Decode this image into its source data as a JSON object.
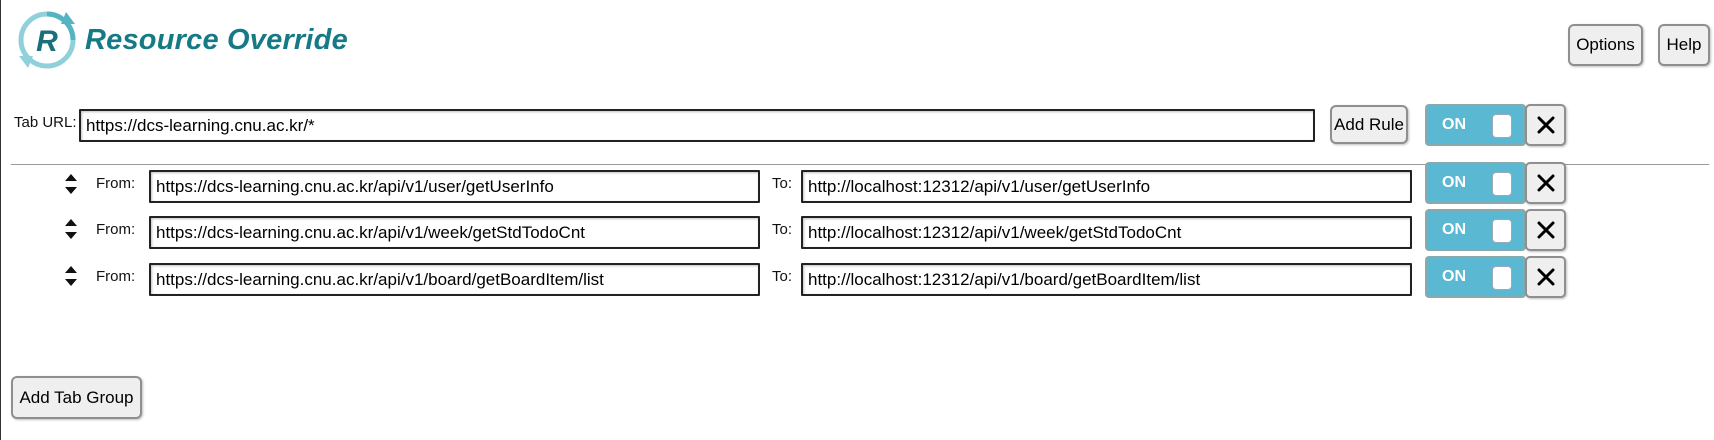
{
  "app": {
    "title": "Resource Override",
    "logo_icon": "resource-override-logo-icon"
  },
  "header": {
    "options_label": "Options",
    "help_label": "Help"
  },
  "tab_group": {
    "tab_url_label": "Tab URL:",
    "tab_url_value": "https://dcs-learning.cnu.ac.kr/*",
    "add_rule_label": "Add Rule",
    "toggle_label": "ON",
    "toggle_state": "on",
    "rules": [
      {
        "from_label": "From:",
        "from_value": "https://dcs-learning.cnu.ac.kr/api/v1/user/getUserInfo",
        "to_label": "To:",
        "to_value": "http://localhost:12312/api/v1/user/getUserInfo",
        "toggle_label": "ON"
      },
      {
        "from_label": "From:",
        "from_value": "https://dcs-learning.cnu.ac.kr/api/v1/week/getStdTodoCnt",
        "to_label": "To:",
        "to_value": "http://localhost:12312/api/v1/week/getStdTodoCnt",
        "toggle_label": "ON"
      },
      {
        "from_label": "From:",
        "from_value": "https://dcs-learning.cnu.ac.kr/api/v1/board/getBoardItem/list",
        "to_label": "To:",
        "to_value": "http://localhost:12312/api/v1/board/getBoardItem/list",
        "toggle_label": "ON"
      }
    ]
  },
  "footer": {
    "add_tab_group_label": "Add Tab Group"
  },
  "colors": {
    "brand": "#167a86",
    "toggle_on": "#5bb8d2"
  }
}
